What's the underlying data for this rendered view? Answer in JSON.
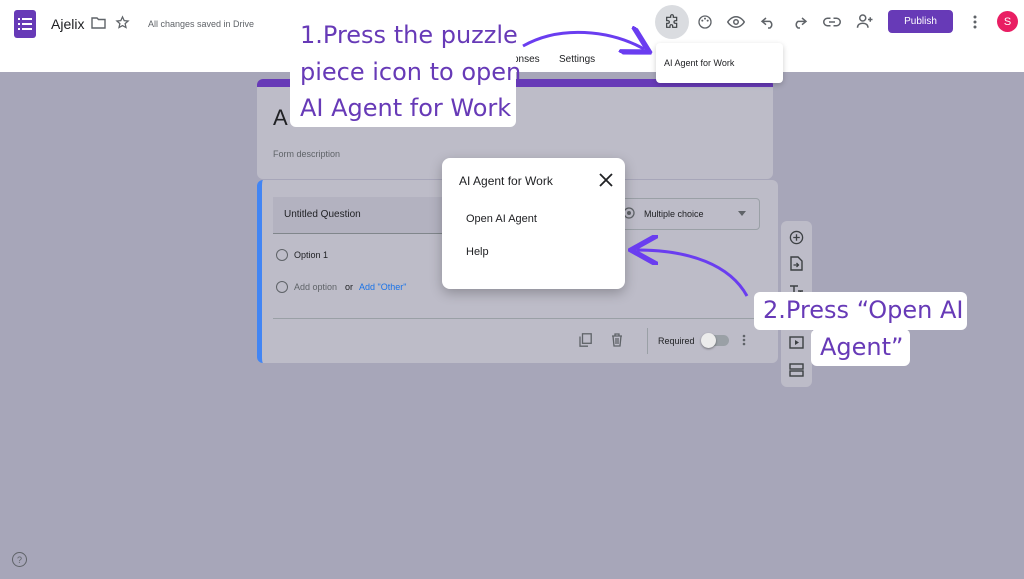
{
  "header": {
    "doc_title": "Ajelix",
    "saved_status": "All changes saved in Drive",
    "publish_label": "Publish",
    "avatar_initial": "S"
  },
  "tabs": {
    "responses_partial": "onses",
    "settings": "Settings"
  },
  "dropdown": {
    "item": "AI Agent for Work"
  },
  "form": {
    "title_partial": "A",
    "description_placeholder": "Form description",
    "question_title": "Untitled Question",
    "question_type": "Multiple choice",
    "option1": "Option 1",
    "add_option": "Add option",
    "or_text": "or",
    "add_other": "Add \"Other\"",
    "required_label": "Required"
  },
  "dialog": {
    "title": "AI Agent for Work",
    "items": [
      "Open AI Agent",
      "Help"
    ]
  },
  "callouts": {
    "step1": [
      "1.Press the puzzle",
      "piece icon to open",
      "AI Agent for Work"
    ],
    "step2": [
      "2.Press “Open AI",
      "Agent”"
    ]
  },
  "icons": [
    "forms-logo-icon",
    "folder-icon",
    "star-icon",
    "puzzle-icon",
    "palette-icon",
    "eye-icon",
    "undo-icon",
    "redo-icon",
    "link-icon",
    "add-person-icon",
    "more-vert-icon",
    "copy-icon",
    "trash-icon",
    "add-circle-icon",
    "import-icon",
    "title-icon",
    "video-icon",
    "section-icon",
    "help-icon",
    "close-icon",
    "arrow-annotation-icon"
  ],
  "colors": {
    "accent": "#673ab7",
    "question_border": "#4285f4",
    "avatar": "#e91e63"
  }
}
